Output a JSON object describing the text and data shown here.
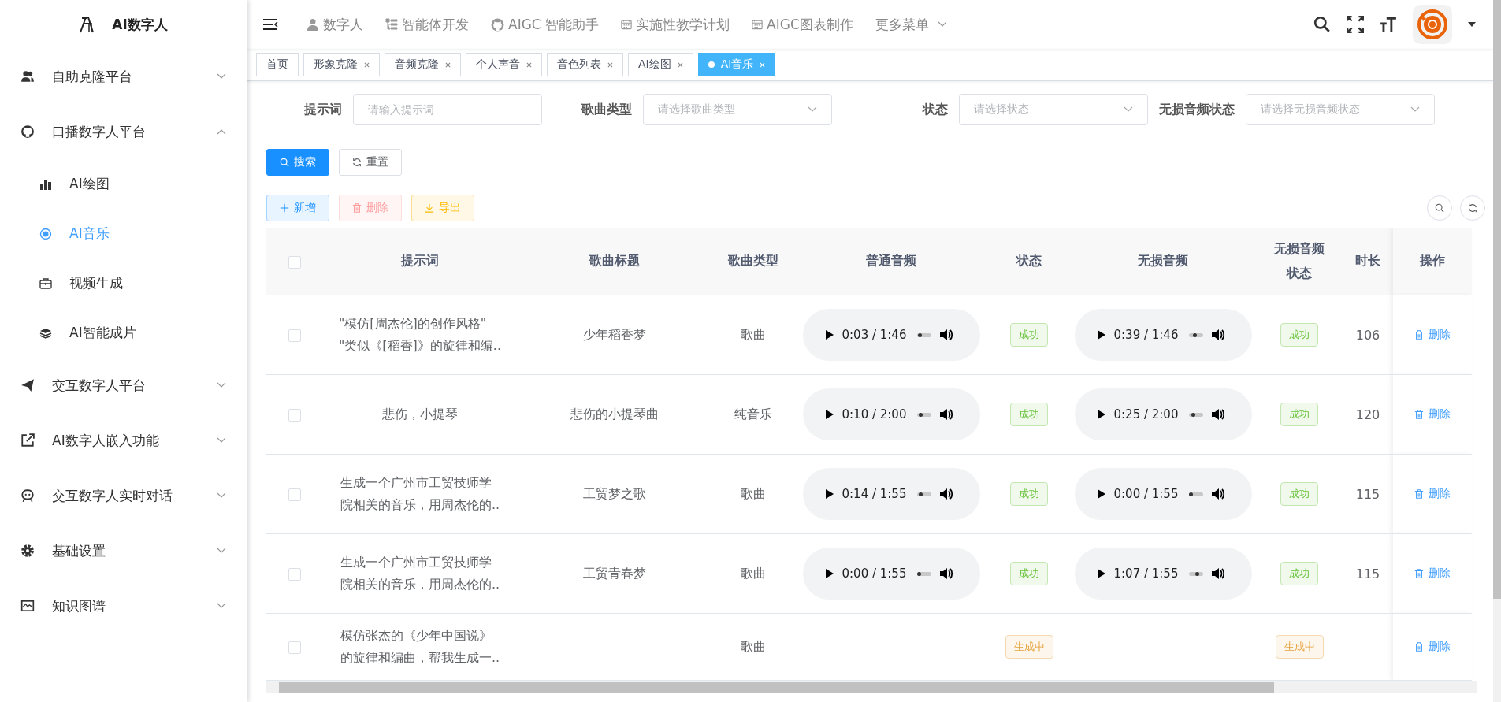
{
  "sidebar": {
    "logo_text": "AI数字人",
    "items": [
      {
        "label": "自助克隆平台",
        "expanded": false
      },
      {
        "label": "口播数字人平台",
        "expanded": true,
        "children": [
          {
            "label": "AI绘图",
            "selected": false
          },
          {
            "label": "AI音乐",
            "selected": true
          },
          {
            "label": "视频生成",
            "selected": false
          },
          {
            "label": "AI智能成片",
            "selected": false
          }
        ]
      },
      {
        "label": "交互数字人平台",
        "expanded": false
      },
      {
        "label": "AI数字人嵌入功能",
        "expanded": false
      },
      {
        "label": "交互数字人实时对话",
        "expanded": false
      },
      {
        "label": "基础设置",
        "expanded": false
      },
      {
        "label": "知识图谱",
        "expanded": false
      }
    ]
  },
  "top_nav": {
    "items": [
      {
        "label": "数字人"
      },
      {
        "label": "智能体开发"
      },
      {
        "label": "AIGC 智能助手"
      },
      {
        "label": "实施性教学计划"
      },
      {
        "label": "AIGC图表制作"
      },
      {
        "label": "更多菜单",
        "kind": "dropdown"
      }
    ]
  },
  "tabs": [
    {
      "label": "首页",
      "selected": false,
      "closable": false
    },
    {
      "label": "形象克隆",
      "selected": false,
      "closable": true
    },
    {
      "label": "音频克隆",
      "selected": false,
      "closable": true
    },
    {
      "label": "个人声音",
      "selected": false,
      "closable": true
    },
    {
      "label": "音色列表",
      "selected": false,
      "closable": true
    },
    {
      "label": "AI绘图",
      "selected": false,
      "closable": true
    },
    {
      "label": "AI音乐",
      "selected": true,
      "closable": true
    }
  ],
  "filters": [
    {
      "label": "提示词",
      "kind": "input",
      "placeholder": "请输入提示词"
    },
    {
      "label": "歌曲类型",
      "kind": "select",
      "placeholder": "请选择歌曲类型"
    },
    {
      "label": "状态",
      "kind": "select",
      "placeholder": "请选择状态"
    },
    {
      "label": "无损音频状态",
      "kind": "select",
      "placeholder": "请选择无损音频状态"
    }
  ],
  "search_buttons": [
    {
      "label": "搜索",
      "kind": "primary"
    },
    {
      "label": "重置",
      "kind": "plain"
    }
  ],
  "toolbar": [
    {
      "label": "新增",
      "kind": "add",
      "disabled": false
    },
    {
      "label": "删除",
      "kind": "delete",
      "disabled": true
    },
    {
      "label": "导出",
      "kind": "export",
      "disabled": false
    }
  ],
  "table": {
    "all_checked": false,
    "columns": [
      "提示词",
      "歌曲标题",
      "歌曲类型",
      "普通音频",
      "状态",
      "无损音频",
      "无损音频状态",
      "时长",
      "操作"
    ],
    "rows": [
      {
        "checked": false,
        "prompt": [
          "\"模仿[周杰伦]的创作风格\"",
          "\"类似《[稻香]》的旋律和编.."
        ],
        "title": "少年稻香梦",
        "type": "歌曲",
        "audio": {
          "time": "0:03 / 1:46",
          "level": 0.03
        },
        "status": {
          "text": "成功",
          "kind": "success"
        },
        "lossless_audio": {
          "time": "0:39 / 1:46",
          "level": 0.37
        },
        "lossless_status": {
          "text": "成功",
          "kind": "success"
        },
        "duration": "106",
        "action": "删除"
      },
      {
        "checked": false,
        "prompt": [
          "悲伤，小提琴"
        ],
        "title": "悲伤的小提琴曲",
        "type": "纯音乐",
        "audio": {
          "time": "0:10 / 2:00",
          "level": 0.08
        },
        "status": {
          "text": "成功",
          "kind": "success"
        },
        "lossless_audio": {
          "time": "0:25 / 2:00",
          "level": 0.21
        },
        "lossless_status": {
          "text": "成功",
          "kind": "success"
        },
        "duration": "120",
        "action": "删除"
      },
      {
        "checked": false,
        "prompt": [
          "生成一个广州市工贸技师学",
          "院相关的音乐，用周杰伦的.."
        ],
        "title": "工贸梦之歌",
        "type": "歌曲",
        "audio": {
          "time": "0:14 / 1:55",
          "level": 0.12
        },
        "status": {
          "text": "成功",
          "kind": "success"
        },
        "lossless_audio": {
          "time": "0:00 / 1:55",
          "level": 0
        },
        "lossless_status": {
          "text": "成功",
          "kind": "success"
        },
        "duration": "115",
        "action": "删除"
      },
      {
        "checked": false,
        "prompt": [
          "生成一个广州市工贸技师学",
          "院相关的音乐，用周杰伦的.."
        ],
        "title": "工贸青春梦",
        "type": "歌曲",
        "audio": {
          "time": "0:00 / 1:55",
          "level": 0
        },
        "status": {
          "text": "成功",
          "kind": "success"
        },
        "lossless_audio": {
          "time": "1:07 / 1:55",
          "level": 0.58
        },
        "lossless_status": {
          "text": "成功",
          "kind": "success"
        },
        "duration": "115",
        "action": "删除"
      },
      {
        "checked": false,
        "prompt": [
          "模仿张杰的《少年中国说》",
          "的旋律和编曲，帮我生成一.."
        ],
        "type": "歌曲",
        "status": {
          "text": "生成中",
          "kind": "pending"
        },
        "lossless_status": {
          "text": "生成中",
          "kind": "pending"
        },
        "action": "删除"
      }
    ]
  }
}
